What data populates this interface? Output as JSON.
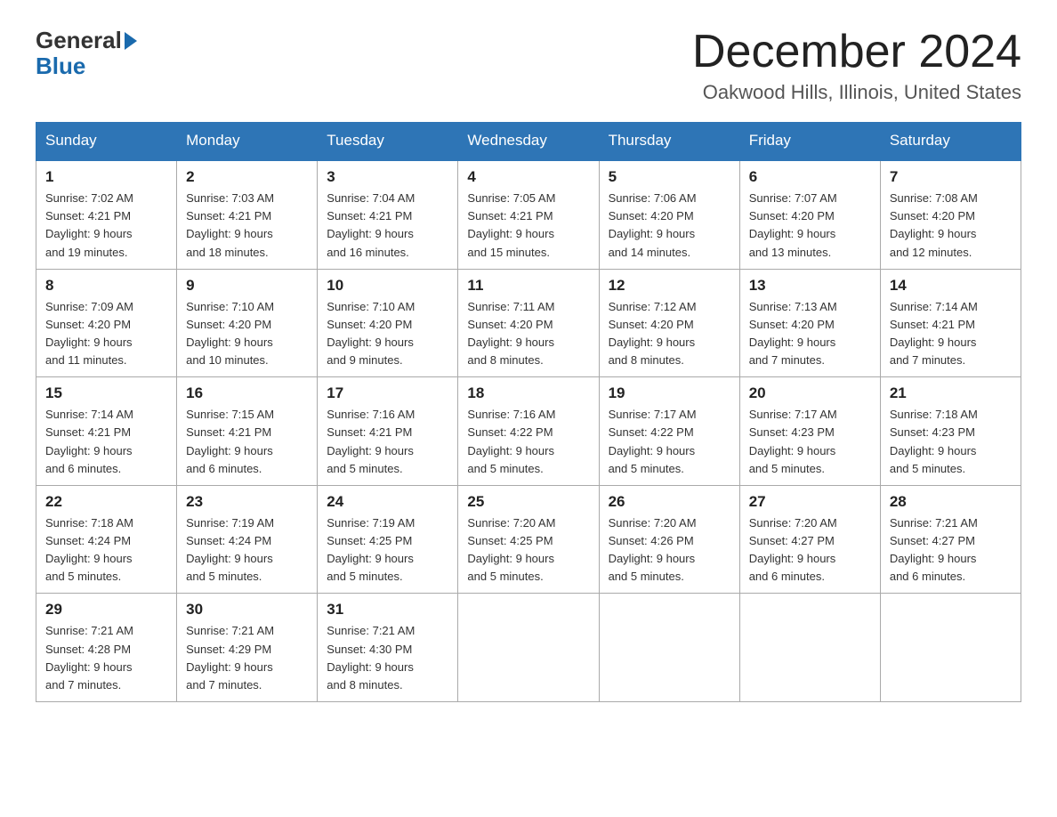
{
  "logo": {
    "general": "General",
    "blue": "Blue",
    "arrow_unicode": "▶"
  },
  "title": "December 2024",
  "location": "Oakwood Hills, Illinois, United States",
  "weekdays": [
    "Sunday",
    "Monday",
    "Tuesday",
    "Wednesday",
    "Thursday",
    "Friday",
    "Saturday"
  ],
  "weeks": [
    [
      {
        "day": "1",
        "sunrise": "7:02 AM",
        "sunset": "4:21 PM",
        "daylight": "9 hours and 19 minutes."
      },
      {
        "day": "2",
        "sunrise": "7:03 AM",
        "sunset": "4:21 PM",
        "daylight": "9 hours and 18 minutes."
      },
      {
        "day": "3",
        "sunrise": "7:04 AM",
        "sunset": "4:21 PM",
        "daylight": "9 hours and 16 minutes."
      },
      {
        "day": "4",
        "sunrise": "7:05 AM",
        "sunset": "4:21 PM",
        "daylight": "9 hours and 15 minutes."
      },
      {
        "day": "5",
        "sunrise": "7:06 AM",
        "sunset": "4:20 PM",
        "daylight": "9 hours and 14 minutes."
      },
      {
        "day": "6",
        "sunrise": "7:07 AM",
        "sunset": "4:20 PM",
        "daylight": "9 hours and 13 minutes."
      },
      {
        "day": "7",
        "sunrise": "7:08 AM",
        "sunset": "4:20 PM",
        "daylight": "9 hours and 12 minutes."
      }
    ],
    [
      {
        "day": "8",
        "sunrise": "7:09 AM",
        "sunset": "4:20 PM",
        "daylight": "9 hours and 11 minutes."
      },
      {
        "day": "9",
        "sunrise": "7:10 AM",
        "sunset": "4:20 PM",
        "daylight": "9 hours and 10 minutes."
      },
      {
        "day": "10",
        "sunrise": "7:10 AM",
        "sunset": "4:20 PM",
        "daylight": "9 hours and 9 minutes."
      },
      {
        "day": "11",
        "sunrise": "7:11 AM",
        "sunset": "4:20 PM",
        "daylight": "9 hours and 8 minutes."
      },
      {
        "day": "12",
        "sunrise": "7:12 AM",
        "sunset": "4:20 PM",
        "daylight": "9 hours and 8 minutes."
      },
      {
        "day": "13",
        "sunrise": "7:13 AM",
        "sunset": "4:20 PM",
        "daylight": "9 hours and 7 minutes."
      },
      {
        "day": "14",
        "sunrise": "7:14 AM",
        "sunset": "4:21 PM",
        "daylight": "9 hours and 7 minutes."
      }
    ],
    [
      {
        "day": "15",
        "sunrise": "7:14 AM",
        "sunset": "4:21 PM",
        "daylight": "9 hours and 6 minutes."
      },
      {
        "day": "16",
        "sunrise": "7:15 AM",
        "sunset": "4:21 PM",
        "daylight": "9 hours and 6 minutes."
      },
      {
        "day": "17",
        "sunrise": "7:16 AM",
        "sunset": "4:21 PM",
        "daylight": "9 hours and 5 minutes."
      },
      {
        "day": "18",
        "sunrise": "7:16 AM",
        "sunset": "4:22 PM",
        "daylight": "9 hours and 5 minutes."
      },
      {
        "day": "19",
        "sunrise": "7:17 AM",
        "sunset": "4:22 PM",
        "daylight": "9 hours and 5 minutes."
      },
      {
        "day": "20",
        "sunrise": "7:17 AM",
        "sunset": "4:23 PM",
        "daylight": "9 hours and 5 minutes."
      },
      {
        "day": "21",
        "sunrise": "7:18 AM",
        "sunset": "4:23 PM",
        "daylight": "9 hours and 5 minutes."
      }
    ],
    [
      {
        "day": "22",
        "sunrise": "7:18 AM",
        "sunset": "4:24 PM",
        "daylight": "9 hours and 5 minutes."
      },
      {
        "day": "23",
        "sunrise": "7:19 AM",
        "sunset": "4:24 PM",
        "daylight": "9 hours and 5 minutes."
      },
      {
        "day": "24",
        "sunrise": "7:19 AM",
        "sunset": "4:25 PM",
        "daylight": "9 hours and 5 minutes."
      },
      {
        "day": "25",
        "sunrise": "7:20 AM",
        "sunset": "4:25 PM",
        "daylight": "9 hours and 5 minutes."
      },
      {
        "day": "26",
        "sunrise": "7:20 AM",
        "sunset": "4:26 PM",
        "daylight": "9 hours and 5 minutes."
      },
      {
        "day": "27",
        "sunrise": "7:20 AM",
        "sunset": "4:27 PM",
        "daylight": "9 hours and 6 minutes."
      },
      {
        "day": "28",
        "sunrise": "7:21 AM",
        "sunset": "4:27 PM",
        "daylight": "9 hours and 6 minutes."
      }
    ],
    [
      {
        "day": "29",
        "sunrise": "7:21 AM",
        "sunset": "4:28 PM",
        "daylight": "9 hours and 7 minutes."
      },
      {
        "day": "30",
        "sunrise": "7:21 AM",
        "sunset": "4:29 PM",
        "daylight": "9 hours and 7 minutes."
      },
      {
        "day": "31",
        "sunrise": "7:21 AM",
        "sunset": "4:30 PM",
        "daylight": "9 hours and 8 minutes."
      },
      null,
      null,
      null,
      null
    ]
  ],
  "labels": {
    "sunrise": "Sunrise: ",
    "sunset": "Sunset: ",
    "daylight": "Daylight: "
  }
}
